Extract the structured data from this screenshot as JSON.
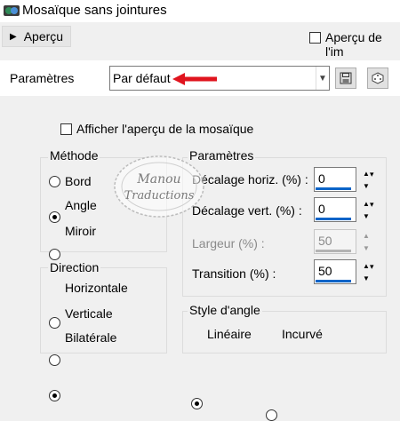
{
  "window": {
    "title": "Mosaïque sans jointures"
  },
  "preview": {
    "toggle_label": "Aperçu",
    "checkbox_label": "Aperçu de l'im"
  },
  "presets": {
    "label": "Paramètres",
    "selected": "Par défaut"
  },
  "show_preview": {
    "label": "Afficher l'aperçu de la mosaïque",
    "checked": false
  },
  "method": {
    "title": "Méthode",
    "options": [
      {
        "label": "Bord",
        "selected": false
      },
      {
        "label": "Angle",
        "selected": true
      },
      {
        "label": "Miroir",
        "selected": false
      }
    ]
  },
  "direction": {
    "title": "Direction",
    "options": [
      {
        "label": "Horizontale",
        "selected": false
      },
      {
        "label": "Verticale",
        "selected": false
      },
      {
        "label": "Bilatérale",
        "selected": true
      }
    ]
  },
  "params": {
    "title": "Paramètres",
    "fields": [
      {
        "label": "Décalage horiz. (%) :",
        "value": "0",
        "enabled": true
      },
      {
        "label": "Décalage vert. (%) :",
        "value": "0",
        "enabled": true
      },
      {
        "label": "Largeur (%) :",
        "value": "50",
        "enabled": false
      },
      {
        "label": "Transition (%) :",
        "value": "50",
        "enabled": true
      }
    ]
  },
  "corner_style": {
    "title": "Style d'angle",
    "options": [
      {
        "label": "Linéaire",
        "selected": true
      },
      {
        "label": "Incurvé",
        "selected": false
      }
    ]
  },
  "watermark": {
    "line1": "Manou",
    "line2": "Traductions"
  },
  "colors": {
    "accent": "#0a64c8",
    "arrow": "#e0141e",
    "panel": "#f0f0f0"
  }
}
